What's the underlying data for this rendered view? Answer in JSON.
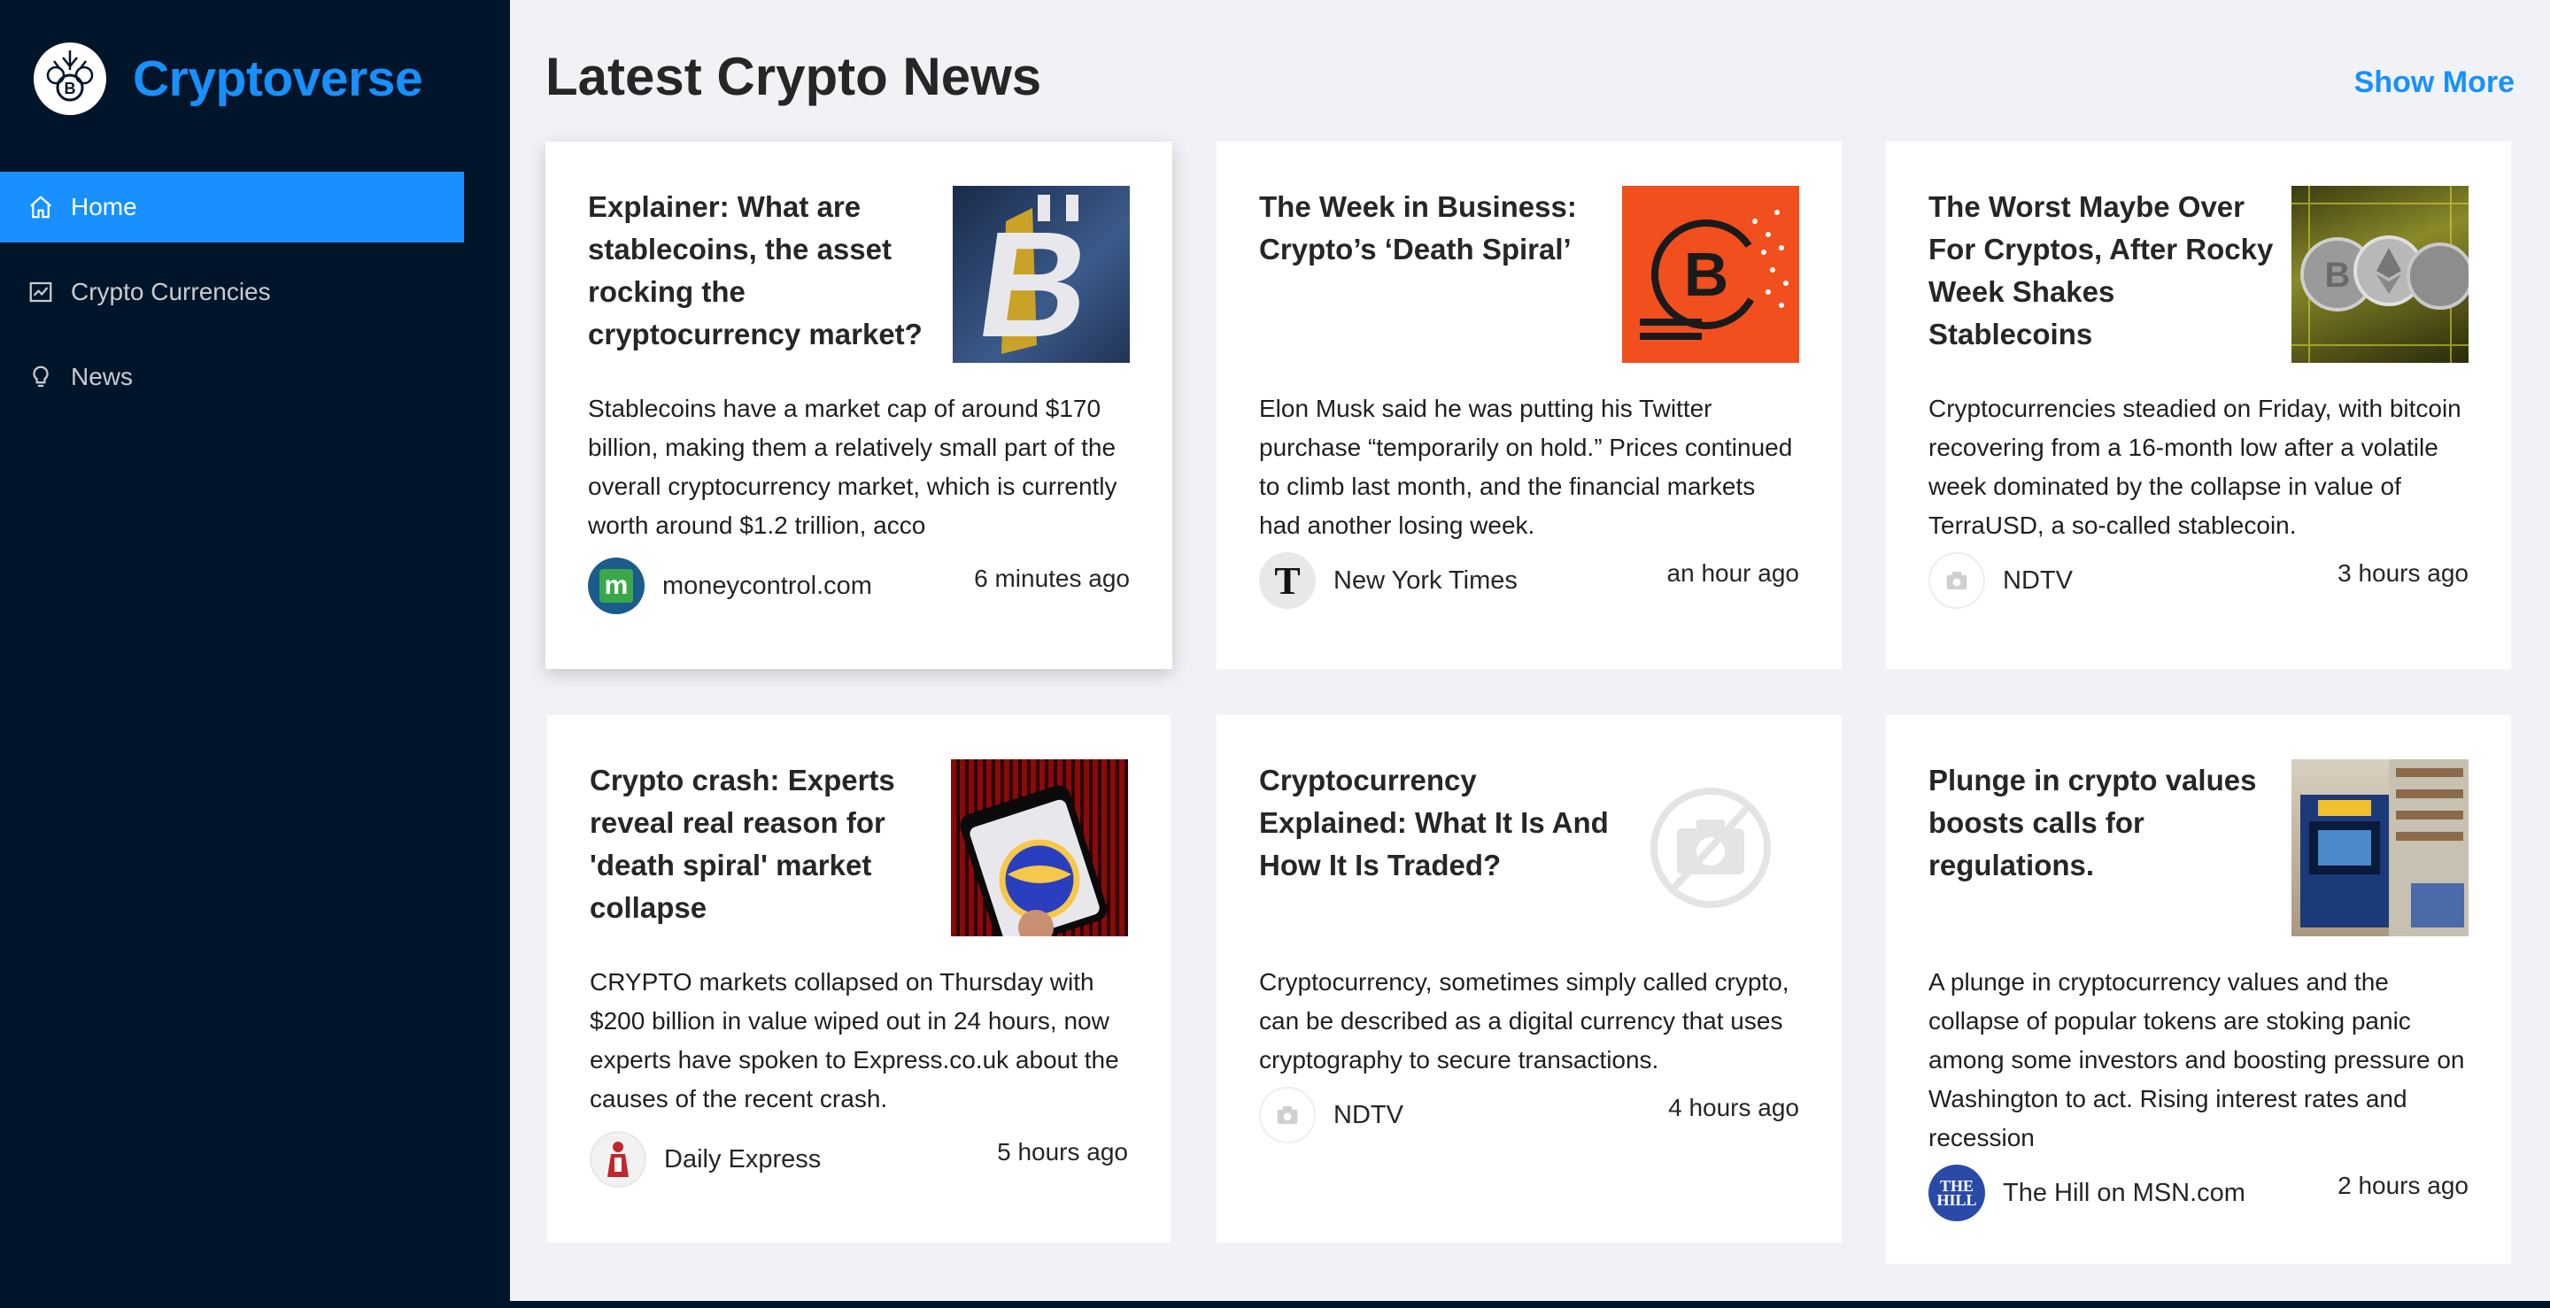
{
  "app": {
    "title": "Cryptoverse"
  },
  "sidebar": {
    "items": [
      {
        "label": "Home",
        "icon": "home-icon",
        "active": true
      },
      {
        "label": "Crypto Currencies",
        "icon": "fund-icon",
        "active": false
      },
      {
        "label": "News",
        "icon": "bulb-icon",
        "active": false
      }
    ]
  },
  "main": {
    "title": "Latest Crypto News",
    "show_more": "Show More"
  },
  "colors": {
    "accent": "#1890ff",
    "sidebar_bg": "#001529",
    "page_bg": "#f0f2f5"
  },
  "news": [
    {
      "title": "Explainer: What are stablecoins, the asset rocking the cryptocurrency market?",
      "description": "Stablecoins have a market cap of around $170 billion, making them a relatively small part of the overall cryptocurrency market, which is currently worth around $1.2 trillion, acco",
      "provider": "moneycontrol.com",
      "time": "6 minutes ago",
      "image": "bitcoin-gold-image"
    },
    {
      "title": "The Week in Business: Crypto’s ‘Death Spiral’",
      "description": "Elon Musk said he was putting his Twitter purchase “temporarily on hold.” Prices continued to climb last month, and the financial markets had another losing week.",
      "provider": "New York Times",
      "time": "an hour ago",
      "image": "bitcoin-orange-image"
    },
    {
      "title": "The Worst Maybe Over For Cryptos, After Rocky Week Shakes Stablecoins",
      "description": "Cryptocurrencies steadied on Friday, with bitcoin recovering from a 16-month low after a volatile week dominated by the collapse in value of TerraUSD, a so-called stablecoin.",
      "provider": "NDTV",
      "time": "3 hours ago",
      "image": "crypto-coins-image"
    },
    {
      "title": "Crypto crash: Experts reveal real reason for 'death spiral' market collapse",
      "description": "CRYPTO markets collapsed on Thursday with $200 billion in value wiped out in 24 hours, now experts have spoken to Express.co.uk about the causes of the recent crash.",
      "provider": "Daily Express",
      "time": "5 hours ago",
      "image": "terra-luna-image"
    },
    {
      "title": "Cryptocurrency Explained: What It Is And How It Is Traded?",
      "description": "Cryptocurrency, sometimes simply called crypto, can be described as a digital currency that uses cryptography to secure transactions.",
      "provider": "NDTV",
      "time": "4 hours ago",
      "image": "no-image-icon"
    },
    {
      "title": "Plunge in crypto values boosts calls for regulations.",
      "description": "A plunge in cryptocurrency values and the collapse of popular tokens are stoking panic among some investors and boosting pressure on Washington to act. Rising interest rates and recession",
      "provider": "The Hill on MSN.com",
      "time": "2 hours ago",
      "image": "crypto-atm-image"
    }
  ]
}
